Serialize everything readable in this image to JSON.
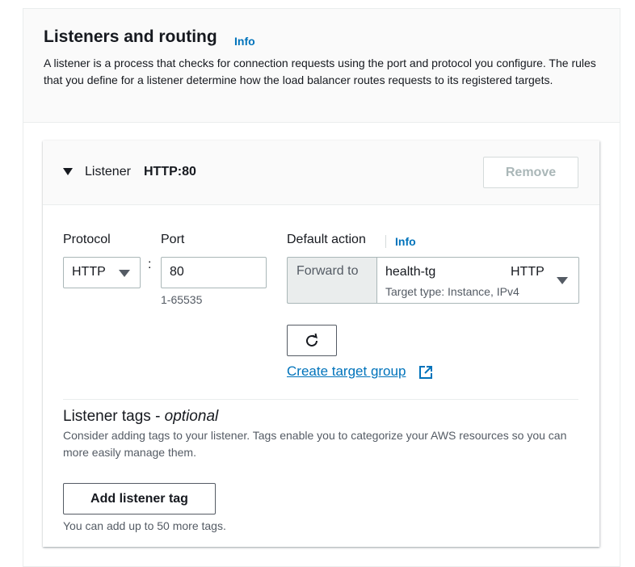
{
  "section": {
    "title": "Listeners and routing",
    "info": "Info",
    "description": "A listener is a process that checks for connection requests using the port and protocol you configure. The rules that you define for a listener determine how the load balancer routes requests to its registered targets."
  },
  "listener": {
    "label": "Listener",
    "name": "HTTP:80",
    "remove_label": "Remove",
    "protocol_label": "Protocol",
    "protocol_value": "HTTP",
    "port_label": "Port",
    "port_value": "80",
    "port_hint": "1-65535",
    "colon": ":",
    "default_action_label": "Default action",
    "default_action_info": "Info",
    "forward_to": "Forward to",
    "target_group_name": "health-tg",
    "target_group_protocol": "HTTP",
    "target_group_detail": "Target type: Instance, IPv4",
    "create_target_group": "Create target group"
  },
  "tags": {
    "title": "Listener tags - ",
    "title_optional": "optional",
    "description": "Consider adding tags to your listener. Tags enable you to categorize your AWS resources so you can more easily manage them.",
    "add_button": "Add listener tag",
    "limit_text": "You can add up to 50 more tags."
  },
  "icons": {
    "caret": "caret-down-icon",
    "refresh": "refresh-icon",
    "external": "external-link-icon"
  },
  "colors": {
    "link": "#0073bb",
    "text": "#16191f",
    "muted": "#545b64"
  }
}
